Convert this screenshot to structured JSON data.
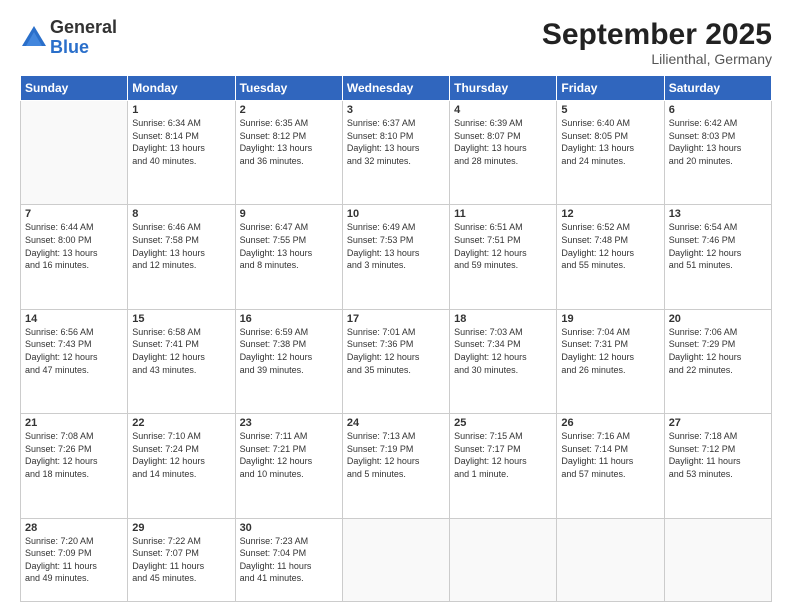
{
  "logo": {
    "general": "General",
    "blue": "Blue"
  },
  "title": "September 2025",
  "subtitle": "Lilienthal, Germany",
  "weekdays": [
    "Sunday",
    "Monday",
    "Tuesday",
    "Wednesday",
    "Thursday",
    "Friday",
    "Saturday"
  ],
  "weeks": [
    [
      {
        "day": "",
        "info": ""
      },
      {
        "day": "1",
        "info": "Sunrise: 6:34 AM\nSunset: 8:14 PM\nDaylight: 13 hours\nand 40 minutes."
      },
      {
        "day": "2",
        "info": "Sunrise: 6:35 AM\nSunset: 8:12 PM\nDaylight: 13 hours\nand 36 minutes."
      },
      {
        "day": "3",
        "info": "Sunrise: 6:37 AM\nSunset: 8:10 PM\nDaylight: 13 hours\nand 32 minutes."
      },
      {
        "day": "4",
        "info": "Sunrise: 6:39 AM\nSunset: 8:07 PM\nDaylight: 13 hours\nand 28 minutes."
      },
      {
        "day": "5",
        "info": "Sunrise: 6:40 AM\nSunset: 8:05 PM\nDaylight: 13 hours\nand 24 minutes."
      },
      {
        "day": "6",
        "info": "Sunrise: 6:42 AM\nSunset: 8:03 PM\nDaylight: 13 hours\nand 20 minutes."
      }
    ],
    [
      {
        "day": "7",
        "info": "Sunrise: 6:44 AM\nSunset: 8:00 PM\nDaylight: 13 hours\nand 16 minutes."
      },
      {
        "day": "8",
        "info": "Sunrise: 6:46 AM\nSunset: 7:58 PM\nDaylight: 13 hours\nand 12 minutes."
      },
      {
        "day": "9",
        "info": "Sunrise: 6:47 AM\nSunset: 7:55 PM\nDaylight: 13 hours\nand 8 minutes."
      },
      {
        "day": "10",
        "info": "Sunrise: 6:49 AM\nSunset: 7:53 PM\nDaylight: 13 hours\nand 3 minutes."
      },
      {
        "day": "11",
        "info": "Sunrise: 6:51 AM\nSunset: 7:51 PM\nDaylight: 12 hours\nand 59 minutes."
      },
      {
        "day": "12",
        "info": "Sunrise: 6:52 AM\nSunset: 7:48 PM\nDaylight: 12 hours\nand 55 minutes."
      },
      {
        "day": "13",
        "info": "Sunrise: 6:54 AM\nSunset: 7:46 PM\nDaylight: 12 hours\nand 51 minutes."
      }
    ],
    [
      {
        "day": "14",
        "info": "Sunrise: 6:56 AM\nSunset: 7:43 PM\nDaylight: 12 hours\nand 47 minutes."
      },
      {
        "day": "15",
        "info": "Sunrise: 6:58 AM\nSunset: 7:41 PM\nDaylight: 12 hours\nand 43 minutes."
      },
      {
        "day": "16",
        "info": "Sunrise: 6:59 AM\nSunset: 7:38 PM\nDaylight: 12 hours\nand 39 minutes."
      },
      {
        "day": "17",
        "info": "Sunrise: 7:01 AM\nSunset: 7:36 PM\nDaylight: 12 hours\nand 35 minutes."
      },
      {
        "day": "18",
        "info": "Sunrise: 7:03 AM\nSunset: 7:34 PM\nDaylight: 12 hours\nand 30 minutes."
      },
      {
        "day": "19",
        "info": "Sunrise: 7:04 AM\nSunset: 7:31 PM\nDaylight: 12 hours\nand 26 minutes."
      },
      {
        "day": "20",
        "info": "Sunrise: 7:06 AM\nSunset: 7:29 PM\nDaylight: 12 hours\nand 22 minutes."
      }
    ],
    [
      {
        "day": "21",
        "info": "Sunrise: 7:08 AM\nSunset: 7:26 PM\nDaylight: 12 hours\nand 18 minutes."
      },
      {
        "day": "22",
        "info": "Sunrise: 7:10 AM\nSunset: 7:24 PM\nDaylight: 12 hours\nand 14 minutes."
      },
      {
        "day": "23",
        "info": "Sunrise: 7:11 AM\nSunset: 7:21 PM\nDaylight: 12 hours\nand 10 minutes."
      },
      {
        "day": "24",
        "info": "Sunrise: 7:13 AM\nSunset: 7:19 PM\nDaylight: 12 hours\nand 5 minutes."
      },
      {
        "day": "25",
        "info": "Sunrise: 7:15 AM\nSunset: 7:17 PM\nDaylight: 12 hours\nand 1 minute."
      },
      {
        "day": "26",
        "info": "Sunrise: 7:16 AM\nSunset: 7:14 PM\nDaylight: 11 hours\nand 57 minutes."
      },
      {
        "day": "27",
        "info": "Sunrise: 7:18 AM\nSunset: 7:12 PM\nDaylight: 11 hours\nand 53 minutes."
      }
    ],
    [
      {
        "day": "28",
        "info": "Sunrise: 7:20 AM\nSunset: 7:09 PM\nDaylight: 11 hours\nand 49 minutes."
      },
      {
        "day": "29",
        "info": "Sunrise: 7:22 AM\nSunset: 7:07 PM\nDaylight: 11 hours\nand 45 minutes."
      },
      {
        "day": "30",
        "info": "Sunrise: 7:23 AM\nSunset: 7:04 PM\nDaylight: 11 hours\nand 41 minutes."
      },
      {
        "day": "",
        "info": ""
      },
      {
        "day": "",
        "info": ""
      },
      {
        "day": "",
        "info": ""
      },
      {
        "day": "",
        "info": ""
      }
    ]
  ]
}
